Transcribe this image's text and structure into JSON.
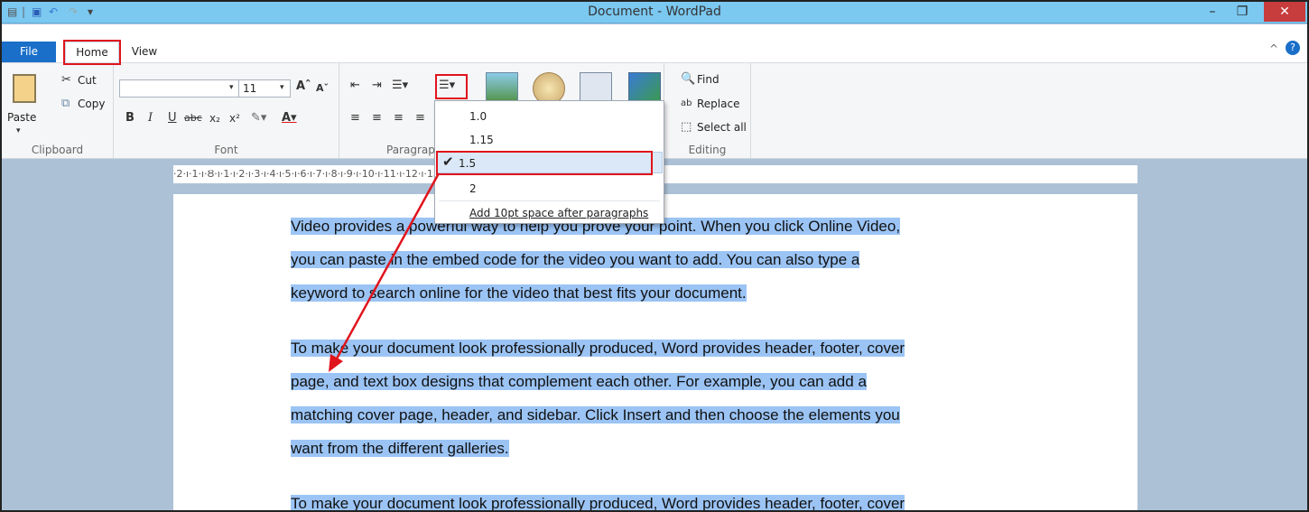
{
  "window": {
    "title": "Document - WordPad",
    "minimize": "–",
    "maximize": "❐",
    "close": "✕"
  },
  "quick_access": {
    "app_icon": "wordpad-icon",
    "save_icon": "save-icon",
    "undo_icon": "undo-icon",
    "redo_icon": "redo-icon",
    "customize": "▾"
  },
  "tabs": {
    "file": "File",
    "home": "Home",
    "view": "View"
  },
  "ribbon": {
    "clipboard": {
      "label": "Clipboard",
      "paste": "Paste",
      "cut": "Cut",
      "copy": "Copy"
    },
    "font": {
      "label": "Font",
      "size": "11"
    },
    "paragraph": {
      "label": "Paragraph"
    },
    "editing": {
      "label": "Editing",
      "find": "Find",
      "replace": "Replace",
      "select_all": "Select all"
    }
  },
  "ruler": {
    "text": "·2·ı·1·ı·Ȣ·ı·1·ı·2·ı·3·ı·4·ı·5·ı·6·ı·7·ı·8·ı·9·ı·10·ı·11·ı·12·ı·13·ı·14·ı·15·ı·16·ı·17·ı·18·"
  },
  "line_spacing_menu": {
    "options": [
      "1.0",
      "1.15",
      "1.5",
      "2"
    ],
    "selected": "1.5",
    "extra": "Add 10pt space after paragraphs"
  },
  "document": {
    "paragraphs": [
      {
        "lines": [
          "Video provides a powerful way to help you prove your point. When you click Online Video,",
          "you can paste in the embed code for the video you want to add. You can also type a",
          "keyword to search online for the video that best fits your document."
        ]
      },
      {
        "lines": [
          "To make your document look professionally produced, Word provides header, footer, cover",
          "page, and text box designs that complement each other. For example, you can add a",
          "matching cover page, header, and sidebar. Click Insert and then choose the elements you",
          "want from the different galleries."
        ]
      },
      {
        "lines": [
          "To make your document look professionally produced, Word provides header, footer, cover"
        ]
      }
    ]
  },
  "colors": {
    "titlebar": "#7bc8f0",
    "file_tab": "#1a6fc9",
    "selection": "#9bc4f5",
    "annotation": "#e0141c",
    "close_button": "#c73c3c"
  }
}
